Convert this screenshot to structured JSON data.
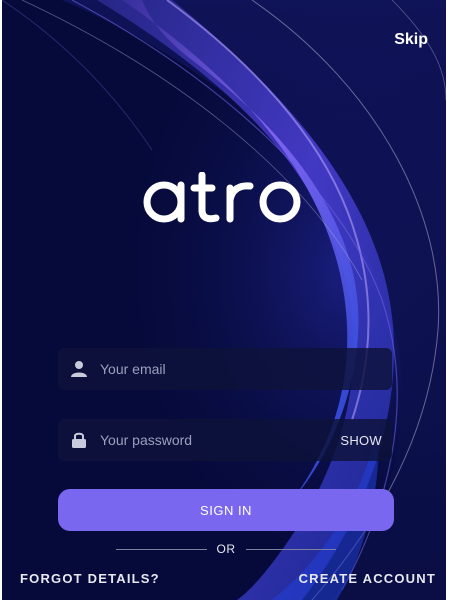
{
  "header": {
    "skip_label": "Skip"
  },
  "logo": {
    "text": "atro"
  },
  "form": {
    "email_placeholder": "Your email",
    "email_value": "",
    "password_placeholder": "Your password",
    "password_value": "",
    "show_label": "SHOW",
    "signin_label": "SIGN IN",
    "or_label": "OR"
  },
  "footer": {
    "forgot_label": "FORGOT DETAILS?",
    "create_label": "CREATE ACCOUNT"
  },
  "icons": {
    "email": "user-icon",
    "password": "lock-icon"
  },
  "colors": {
    "background": "#060a3a",
    "accent": "#7a67f0",
    "field_background": "#0e123a",
    "placeholder": "#9aa0bd"
  }
}
